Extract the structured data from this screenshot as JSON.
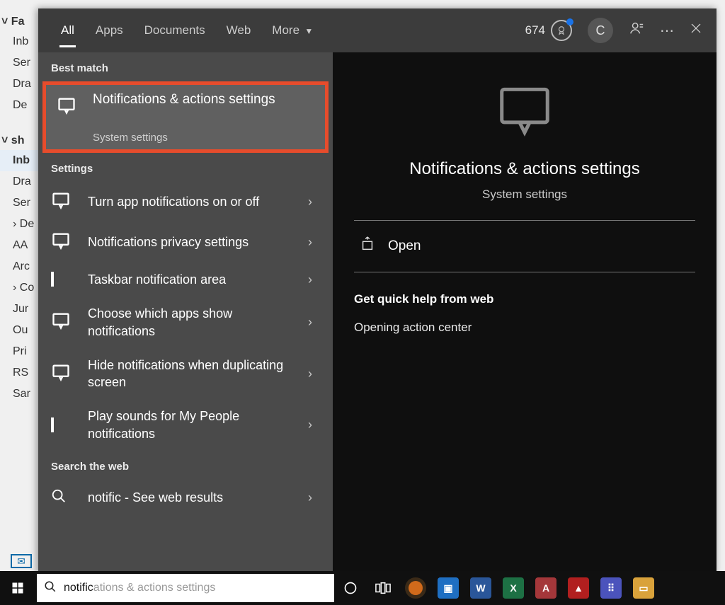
{
  "background_sidebar": {
    "group1_label": "Fa",
    "items1": [
      "Inb",
      "Ser",
      "Dra",
      "De"
    ],
    "group2_label": "sh",
    "items2": [
      "Inb",
      "Dra",
      "Ser",
      "De",
      "AA",
      "Arc",
      "Co",
      "Jur",
      "Ou",
      "Pri",
      "RS",
      "Sar"
    ]
  },
  "tabs": {
    "all": "All",
    "apps": "Apps",
    "documents": "Documents",
    "web": "Web",
    "more": "More"
  },
  "header_right": {
    "points": "674",
    "avatar_letter": "C"
  },
  "left_panel": {
    "best_match_header": "Best match",
    "best_match_title": "Notifications & actions settings",
    "best_match_subtitle": "System settings",
    "settings_header": "Settings",
    "settings_rows": [
      "Turn app notifications on or off",
      "Notifications privacy settings",
      "Taskbar notification area",
      "Choose which apps show notifications",
      "Hide notifications when duplicating screen",
      "Play sounds for My People notifications"
    ],
    "search_web_header": "Search the web",
    "search_web_row": "notific - See web results"
  },
  "right_panel": {
    "title": "Notifications & actions settings",
    "subtitle": "System settings",
    "open_label": "Open",
    "quick_help_header": "Get quick help from web",
    "quick_help_item": "Opening action center"
  },
  "search_box": {
    "typed": "notific",
    "suffix": "ations & actions settings"
  },
  "taskbar": {
    "apps": [
      {
        "label": "W"
      },
      {
        "label": "X"
      },
      {
        "label": "A"
      },
      {
        "label": ""
      },
      {
        "label": ""
      },
      {
        "label": ""
      }
    ]
  }
}
